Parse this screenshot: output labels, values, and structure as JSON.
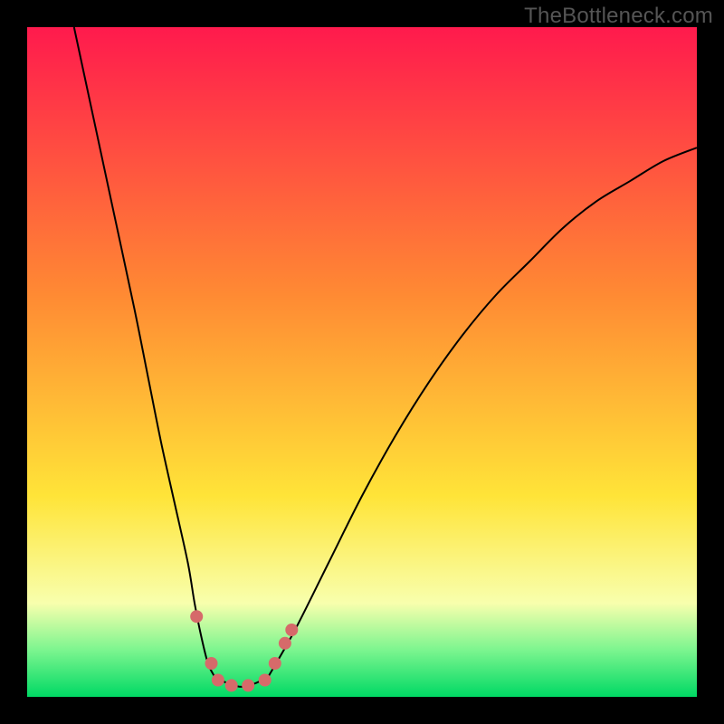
{
  "watermark": "TheBottleneck.com",
  "colors": {
    "grad_top": "#ff1a4d",
    "grad_mid_orange": "#ff8a33",
    "grad_yellow": "#ffe438",
    "grad_pale": "#f8ffad",
    "grad_green_light": "#7cf58f",
    "grad_green": "#00d964",
    "curve": "#000000",
    "dot": "#d66a6a",
    "frame": "#000000"
  },
  "chart_data": {
    "type": "line",
    "title": "",
    "xlabel": "",
    "ylabel": "",
    "xlim": [
      0,
      100
    ],
    "ylim": [
      0,
      100
    ],
    "series": [
      {
        "name": "left-branch",
        "x": [
          7,
          10,
          13,
          16,
          18,
          20,
          22,
          24,
          25,
          26,
          27,
          28
        ],
        "y": [
          100,
          86,
          72,
          58,
          48,
          38,
          29,
          20,
          14,
          9,
          5,
          3
        ]
      },
      {
        "name": "valley-floor",
        "x": [
          28,
          30,
          32,
          34,
          36
        ],
        "y": [
          3,
          2,
          1.5,
          2,
          3
        ]
      },
      {
        "name": "right-branch",
        "x": [
          36,
          40,
          45,
          50,
          55,
          60,
          65,
          70,
          75,
          80,
          85,
          90,
          95,
          100
        ],
        "y": [
          3,
          10,
          20,
          30,
          39,
          47,
          54,
          60,
          65,
          70,
          74,
          77,
          80,
          82
        ]
      }
    ],
    "points": [
      {
        "name": "pt-left-upper",
        "x": 25.3,
        "y": 12
      },
      {
        "name": "pt-left-mid",
        "x": 27.5,
        "y": 5
      },
      {
        "name": "pt-left-low",
        "x": 28.5,
        "y": 2.5
      },
      {
        "name": "pt-floor-a",
        "x": 30.5,
        "y": 1.7
      },
      {
        "name": "pt-floor-b",
        "x": 33.0,
        "y": 1.7
      },
      {
        "name": "pt-right-low",
        "x": 35.5,
        "y": 2.5
      },
      {
        "name": "pt-right-mid",
        "x": 37.0,
        "y": 5
      },
      {
        "name": "pt-right-up1",
        "x": 38.5,
        "y": 8
      },
      {
        "name": "pt-right-up2",
        "x": 39.5,
        "y": 10
      }
    ],
    "gradient_stops": [
      {
        "offset": 0,
        "color_key": "grad_top"
      },
      {
        "offset": 0.4,
        "color_key": "grad_mid_orange"
      },
      {
        "offset": 0.7,
        "color_key": "grad_yellow"
      },
      {
        "offset": 0.86,
        "color_key": "grad_pale"
      },
      {
        "offset": 0.93,
        "color_key": "grad_green_light"
      },
      {
        "offset": 1.0,
        "color_key": "grad_green"
      }
    ]
  }
}
